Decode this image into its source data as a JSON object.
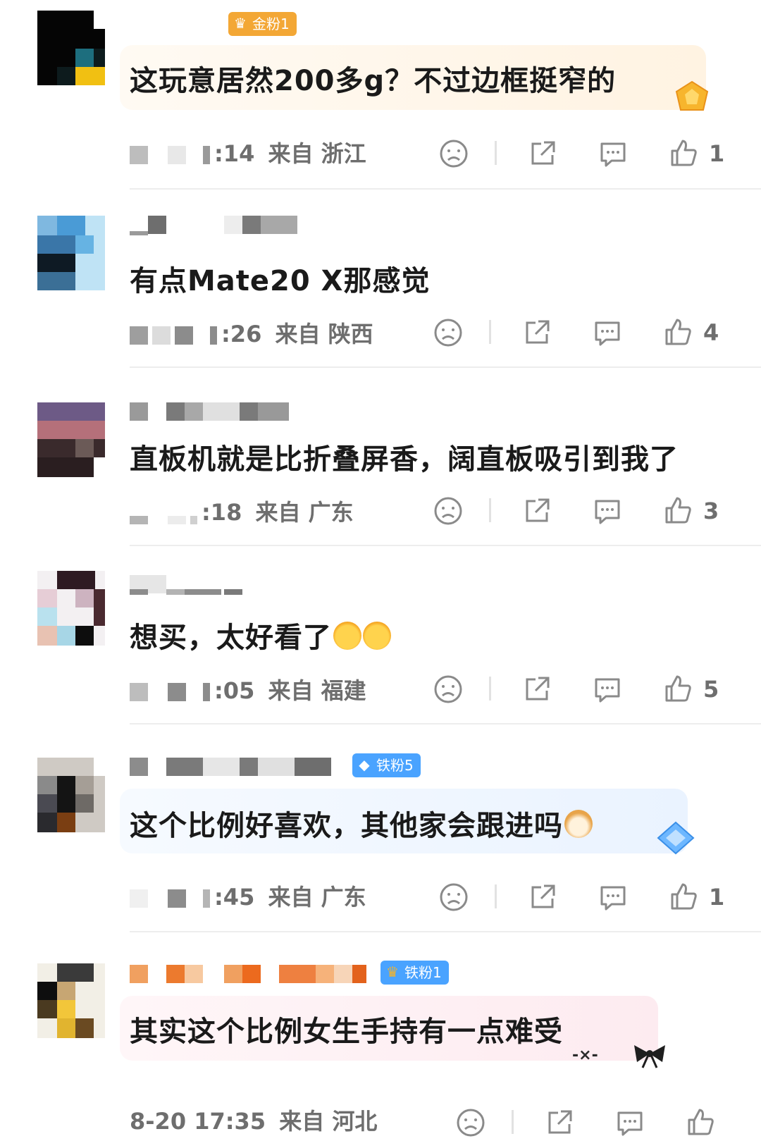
{
  "colors": {
    "text": "#1a1a1a",
    "meta": "#6e6e6e",
    "gold_badge": "#f3a735",
    "blue_badge": "#4aa3ff",
    "icon": "#8a8a8a"
  },
  "comments": [
    {
      "badge": "金粉1",
      "badge_icon": "crown-icon",
      "text": "这玩意居然200多g？不过边框挺窄的",
      "time": ":14",
      "location": "来自 浙江",
      "likes": "1"
    },
    {
      "text": "有点Mate20 X那感觉",
      "time": ":26",
      "location": "来自 陕西",
      "likes": "4"
    },
    {
      "text": "直板机就是比折叠屏香，阔直板吸引到我了",
      "time": ":18",
      "location": "来自 广东",
      "likes": "3"
    },
    {
      "text": "想买，太好看了",
      "emojis": [
        "flower-face-emoji",
        "flower-face-emoji"
      ],
      "time": ":05",
      "location": "来自 福建",
      "likes": "5"
    },
    {
      "badge": "铁粉5",
      "badge_icon": "diamond-icon",
      "text": "这个比例好喜欢，其他家会跟进吗",
      "emojis": [
        "dog-face-emoji"
      ],
      "time": ":45",
      "location": "来自 广东",
      "likes": "1"
    },
    {
      "badge": "铁粉1",
      "badge_icon": "crown-icon",
      "text": "其实这个比例女生手持有一点难受",
      "bubble_deco": "-×-",
      "time": "8-20 17:35",
      "location": "来自 河北",
      "likes": ""
    }
  ]
}
